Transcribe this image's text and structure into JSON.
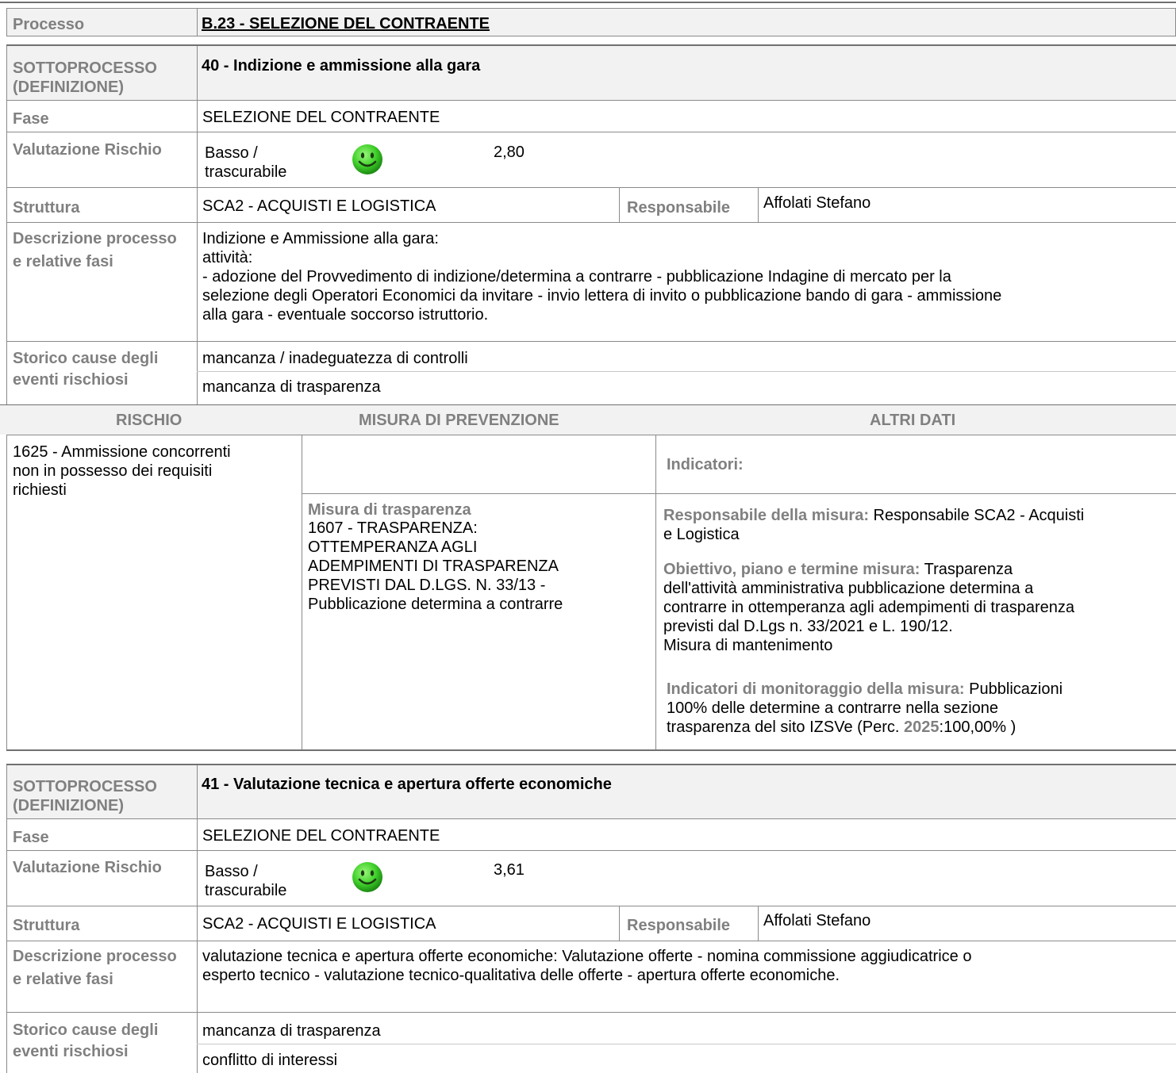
{
  "processo": {
    "label": "Processo",
    "value": "B.23 - SELEZIONE DEL CONTRAENTE"
  },
  "labels": {
    "sottoprocesso": "SOTTOPROCESSO (DEFINIZIONE)",
    "fase": "Fase",
    "valutazione": "Valutazione Rischio",
    "struttura": "Struttura",
    "responsabile": "Responsabile",
    "descrizione": "Descrizione processo e relative fasi",
    "storico": "Storico cause degli eventi rischiosi"
  },
  "sub1": {
    "title": "40 - Indizione e ammissione alla gara",
    "fase": "SELEZIONE DEL CONTRAENTE",
    "risk_level": "Basso / trascurabile",
    "risk_icon": "smiley-green-icon",
    "risk_score": "2,80",
    "struttura": "SCA2 - ACQUISTI E LOGISTICA",
    "responsabile": "Affolati Stefano",
    "descrizione_lines": [
      "Indizione e Ammissione alla gara:",
      "attività:",
      "- adozione del Provvedimento di indizione/determina a contrarre - pubblicazione Indagine di mercato per la",
      "selezione degli Operatori Economici da invitare - invio lettera di invito o pubblicazione bando di gara - ammissione",
      "alla gara - eventuale soccorso istruttorio."
    ],
    "storico": [
      "mancanza / inadeguatezza di controlli",
      "mancanza di trasparenza"
    ],
    "table_headers": {
      "rischio": "RISCHIO",
      "misura": "MISURA DI PREVENZIONE",
      "altri": "ALTRI DATI"
    },
    "rischio_lines": [
      "1625 - Ammissione concorrenti",
      "non in possesso dei requisiti",
      "richiesti"
    ],
    "indicatori_label": "Indicatori:",
    "misura_title": "Misura di trasparenza",
    "misura_lines": [
      "1607 - TRASPARENZA:",
      "OTTEMPERANZA AGLI",
      "ADEMPIMENTI DI TRASPARENZA",
      "PREVISTI DAL D.LGS. N. 33/13  -",
      "Pubblicazione determina a contrarre"
    ],
    "resp_misura_label": "Responsabile della misura:",
    "resp_misura_l1": " Responsabile SCA2 - Acquisti",
    "resp_misura_l2": "e Logistica",
    "obiettivo_label": "Obiettivo, piano e termine misura:",
    "obiettivo_l1": " Trasparenza",
    "obiettivo_lines": [
      "dell'attività amministrativa pubblicazione determina a",
      "contrarre in ottemperanza agli adempimenti di trasparenza",
      "previsti dal D.Lgs n. 33/2021 e L. 190/12.",
      "Misura di mantenimento"
    ],
    "indicatori_mon_label": "Indicatori di monitoraggio della misura:",
    "indicatori_mon_l1": " Pubblicazioni",
    "indicatori_mon_lines": [
      "100% delle determine a contrarre nella sezione"
    ],
    "indicatori_mon_l3a": "trasparenza del sito IZSVe (Perc. ",
    "indicatori_mon_year": "2025",
    "indicatori_mon_l3b": ":100,00%  )"
  },
  "sub2": {
    "title": "41 - Valutazione tecnica e apertura offerte economiche",
    "fase": "SELEZIONE DEL CONTRAENTE",
    "risk_level": "Basso / trascurabile",
    "risk_icon": "smiley-green-icon",
    "risk_score": "3,61",
    "struttura": "SCA2 - ACQUISTI E LOGISTICA",
    "responsabile": "Affolati Stefano",
    "descrizione_lines": [
      "valutazione tecnica e apertura offerte economiche: Valutazione offerte - nomina commissione aggiudicatrice o",
      "esperto tecnico - valutazione tecnico-qualitativa delle offerte - apertura offerte economiche."
    ],
    "storico": [
      "mancanza di trasparenza",
      "conflitto di interessi"
    ]
  },
  "colors": {
    "label_gray": "#808080",
    "header_bg": "#f2f2f2",
    "border": "#707070",
    "smiley_green": "#3fcf2a"
  }
}
